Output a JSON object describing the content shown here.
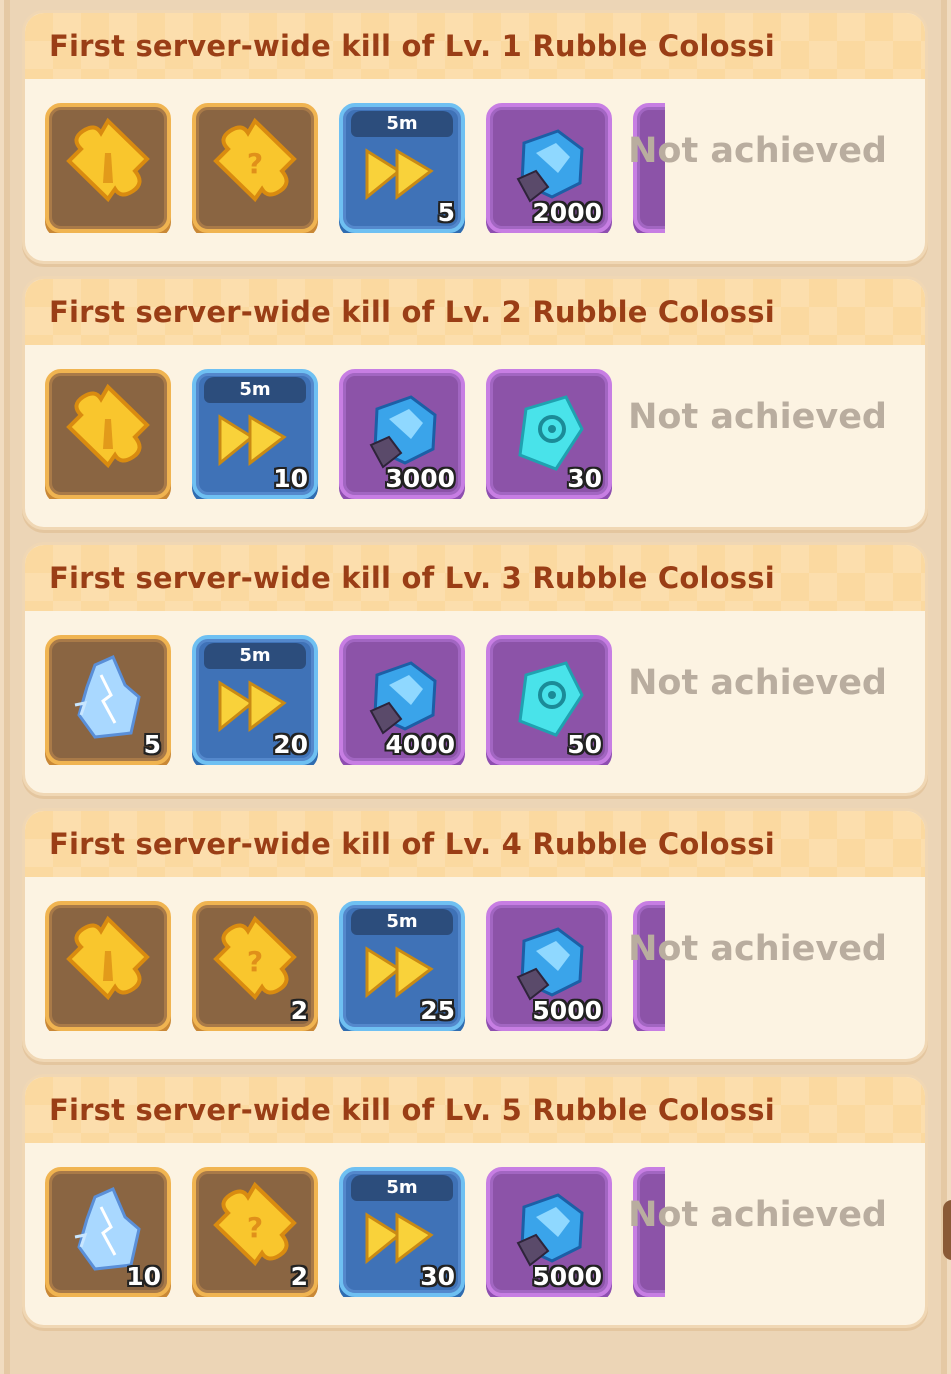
{
  "colors": {
    "header_text": "#9a3e16",
    "status_text": "#b9ad9f",
    "card_bg": "#fcf3e2",
    "header_bg": "#fbd9a0"
  },
  "rows": [
    {
      "title": "First server-wide kill of Lv. 1 Rubble Colossi",
      "status": "Not achieved",
      "rewards": [
        {
          "icon": "gold-puzzle-piece-icon",
          "frame": "gold",
          "qty": ""
        },
        {
          "icon": "mystery-puzzle-piece-icon",
          "frame": "gold",
          "qty": ""
        },
        {
          "icon": "speedup-icon",
          "frame": "blue",
          "timer": "5m",
          "qty": "5"
        },
        {
          "icon": "blue-ore-icon",
          "frame": "purple",
          "qty": "2000"
        }
      ]
    },
    {
      "title": "First server-wide kill of Lv. 2 Rubble Colossi",
      "status": "Not achieved",
      "rewards": [
        {
          "icon": "gold-puzzle-piece-icon",
          "frame": "gold",
          "qty": ""
        },
        {
          "icon": "speedup-icon",
          "frame": "blue",
          "timer": "5m",
          "qty": "10"
        },
        {
          "icon": "blue-ore-icon",
          "frame": "purple",
          "qty": "3000"
        },
        {
          "icon": "rune-stone-icon",
          "frame": "purple",
          "qty": "30"
        }
      ]
    },
    {
      "title": "First server-wide kill of Lv. 3 Rubble Colossi",
      "status": "Not achieved",
      "rewards": [
        {
          "icon": "lightning-crystal-icon",
          "frame": "gold",
          "qty": "5"
        },
        {
          "icon": "speedup-icon",
          "frame": "blue",
          "timer": "5m",
          "qty": "20"
        },
        {
          "icon": "blue-ore-icon",
          "frame": "purple",
          "qty": "4000"
        },
        {
          "icon": "rune-stone-icon",
          "frame": "purple",
          "qty": "50"
        }
      ]
    },
    {
      "title": "First server-wide kill of Lv. 4 Rubble Colossi",
      "status": "Not achieved",
      "rewards": [
        {
          "icon": "gold-puzzle-piece-icon",
          "frame": "gold",
          "qty": ""
        },
        {
          "icon": "mystery-puzzle-piece-icon",
          "frame": "gold",
          "qty": "2"
        },
        {
          "icon": "speedup-icon",
          "frame": "blue",
          "timer": "5m",
          "qty": "25"
        },
        {
          "icon": "blue-ore-icon",
          "frame": "purple",
          "qty": "5000"
        }
      ]
    },
    {
      "title": "First server-wide kill of Lv. 5 Rubble Colossi",
      "status": "Not achieved",
      "rewards": [
        {
          "icon": "lightning-crystal-icon",
          "frame": "gold",
          "qty": "10"
        },
        {
          "icon": "mystery-puzzle-piece-icon",
          "frame": "gold",
          "qty": "2"
        },
        {
          "icon": "speedup-icon",
          "frame": "blue",
          "timer": "5m",
          "qty": "30"
        },
        {
          "icon": "blue-ore-icon",
          "frame": "purple",
          "qty": "5000"
        }
      ]
    }
  ]
}
